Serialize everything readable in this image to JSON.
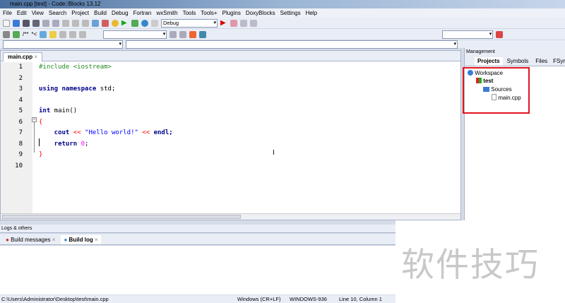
{
  "window": {
    "title": "main.cpp [test] - Code::Blocks 13.12"
  },
  "menu": [
    "File",
    "Edit",
    "View",
    "Search",
    "Project",
    "Build",
    "Debug",
    "Fortran",
    "wxSmith",
    "Tools",
    "Tools+",
    "Plugins",
    "DoxyBlocks",
    "Settings",
    "Help"
  ],
  "toolbar": {
    "build_target": "Debug",
    "doxy_comment": "/**",
    "doxy_line": "*<"
  },
  "editor": {
    "tab": "main.cpp",
    "close": "×",
    "lines": [
      "1",
      "2",
      "3",
      "4",
      "5",
      "6",
      "7",
      "8",
      "9",
      "10"
    ],
    "code": {
      "l1": "#include <iostream>",
      "l3a": "using namespace",
      "l3b": " std;",
      "l5a": "int",
      "l5b": " main()",
      "l6": "{",
      "l7a": "    cout ",
      "l7b": "<<",
      "l7c": " \"Hello world!\" ",
      "l7d": "<<",
      "l7e": " endl;",
      "l8a": "    return",
      "l8b": " 0",
      "l8c": ";",
      "l9": "}"
    }
  },
  "management": {
    "title": "Management",
    "tabs": [
      "Projects",
      "Symbols",
      "Files",
      "FSymb"
    ],
    "tree": {
      "workspace": "Workspace",
      "project": "test",
      "folder": "Sources",
      "file": "main.cpp"
    },
    "highlight_color": "#e0141e"
  },
  "logs": {
    "title": "Logs & others",
    "tabs": [
      "Build messages",
      "Build log"
    ],
    "active_tab": "Build log"
  },
  "status": {
    "path": "C:\\Users\\Administrator\\Desktop\\test\\main.cpp",
    "eol": "Windows (CR+LF)",
    "encoding": "WINDOWS-936",
    "position": "Line 10, Column 1"
  },
  "watermark": "软件技巧"
}
